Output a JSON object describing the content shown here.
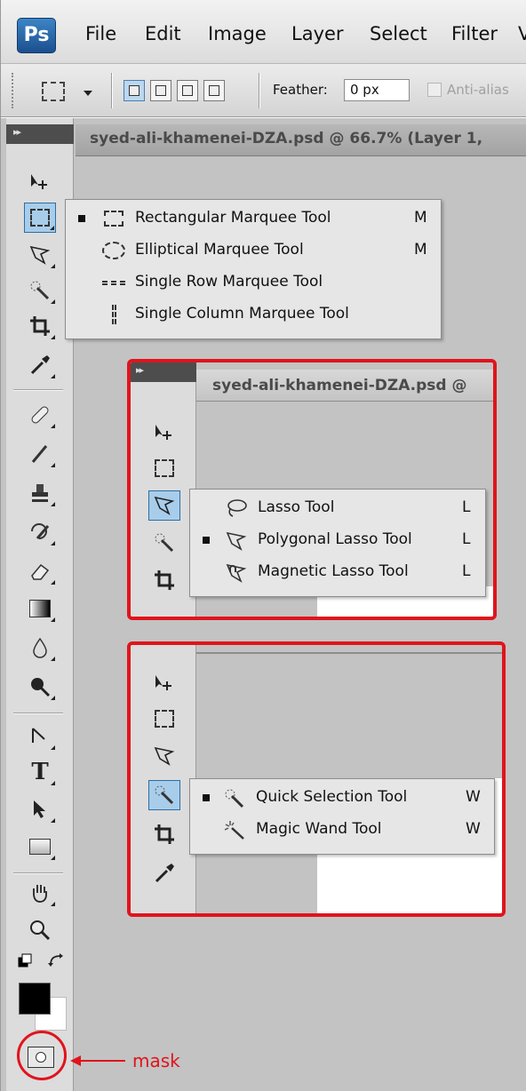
{
  "app": {
    "logo": "Ps"
  },
  "menu": [
    "File",
    "Edit",
    "Image",
    "Layer",
    "Select",
    "Filter",
    "V"
  ],
  "options_bar": {
    "feather_label": "Feather:",
    "feather_value": "0 px",
    "anti_alias_label": "Anti-alias",
    "anti_alias_checked": false
  },
  "panel": {
    "collapse_glyph": "▸▸"
  },
  "document": {
    "tab_title": "syed-ali-khamenei-DZA.psd @ 66.7% (Layer 1,"
  },
  "marquee_flyout": {
    "items": [
      {
        "label": "Rectangular Marquee Tool",
        "key": "M",
        "selected": true,
        "icon": "rect-marquee-icon"
      },
      {
        "label": "Elliptical Marquee Tool",
        "key": "M",
        "selected": false,
        "icon": "ellipse-marquee-icon"
      },
      {
        "label": "Single Row Marquee Tool",
        "key": "",
        "selected": false,
        "icon": "single-row-marquee-icon"
      },
      {
        "label": "Single Column Marquee Tool",
        "key": "",
        "selected": false,
        "icon": "single-column-marquee-icon"
      }
    ]
  },
  "inset_lasso": {
    "tab_title": "syed-ali-khamenei-DZA.psd @",
    "items": [
      {
        "label": "Lasso Tool",
        "key": "L",
        "selected": false,
        "icon": "lasso-icon"
      },
      {
        "label": "Polygonal Lasso Tool",
        "key": "L",
        "selected": true,
        "icon": "polygonal-lasso-icon"
      },
      {
        "label": "Magnetic Lasso Tool",
        "key": "L",
        "selected": false,
        "icon": "magnetic-lasso-icon"
      }
    ]
  },
  "inset_quick": {
    "items": [
      {
        "label": "Quick Selection Tool",
        "key": "W",
        "selected": true,
        "icon": "quick-selection-icon"
      },
      {
        "label": "Magic Wand Tool",
        "key": "W",
        "selected": false,
        "icon": "magic-wand-icon"
      }
    ]
  },
  "annotation": {
    "label": "mask",
    "color": "#e0141c"
  },
  "colors": {
    "accent_red": "#e0141c",
    "active_tool": "#a8cdea",
    "foreground": "#000000",
    "background": "#ffffff"
  }
}
